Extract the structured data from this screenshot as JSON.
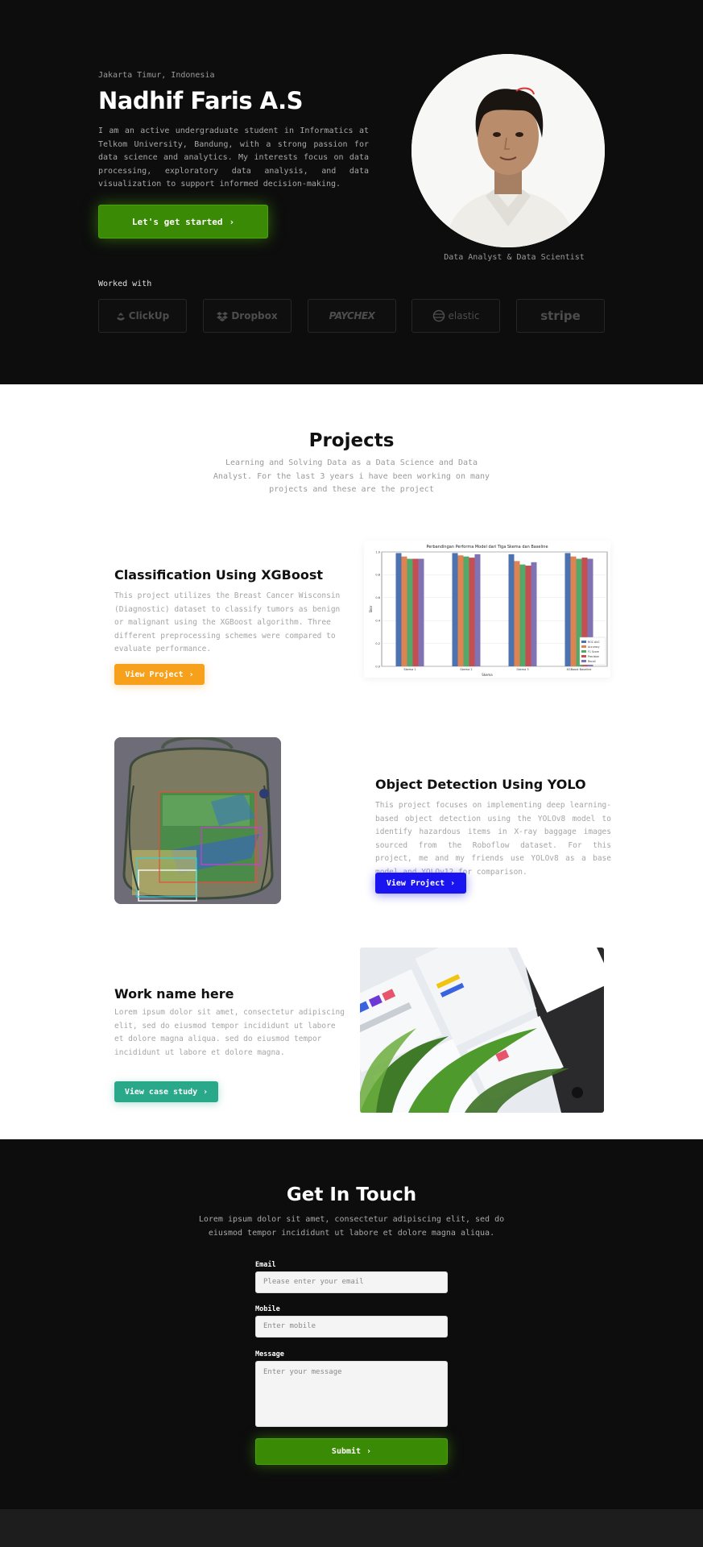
{
  "hero": {
    "location": "Jakarta Timur, Indonesia",
    "name": "Nadhif Faris A.S",
    "description": "I am an active undergraduate student in Informatics at Telkom University, Bandung, with a strong passion for data science and analytics. My interests focus on data processing, exploratory data analysis, and data visualization to support informed decision-making.",
    "cta_label": "Let's get started",
    "role": "Data Analyst & Data Scientist",
    "worked_with_label": "Worked with",
    "logos": [
      "ClickUp",
      "Dropbox",
      "PAYCHEX",
      "elastic",
      "stripe"
    ]
  },
  "projects": {
    "title": "Projects",
    "subtitle": "Learning and Solving Data as a Data Science and Data Analyst. For the last 3 years i have been working on many projects and these are the project",
    "items": [
      {
        "title": "Classification Using XGBoost",
        "description": "This project utilizes the Breast Cancer Wisconsin (Diagnostic) dataset to classify tumors as benign or malignant using the XGBoost algorithm. Three different preprocessing schemes were compared to evaluate performance.",
        "button": "View Project"
      },
      {
        "title": "Object Detection Using YOLO",
        "description": "This project focuses on implementing deep learning-based object detection using the YOLOv8 model to identify hazardous items in X-ray baggage images sourced from the Roboflow dataset. For this project, me and my friends use YOLOv8 as a base model and YOLOv12 for comparison.",
        "button": "View Project"
      },
      {
        "title": "Work name here",
        "description": "Lorem ipsum dolor sit amet, consectetur adipiscing elit, sed do eiusmod tempor incididunt ut labore et dolore magna aliqua. sed do eiusmod tempor incididunt ut labore et dolore magna.",
        "button": "View case study"
      }
    ]
  },
  "chart_data": {
    "type": "bar",
    "title": "Perbandingan Performa Model dari Tiga Skema dan Baseline",
    "xlabel": "Skema",
    "ylabel": "Skor",
    "ylim": [
      0,
      1.0
    ],
    "yticks": [
      "0.0",
      "0.2",
      "0.4",
      "0.6",
      "0.8",
      "1.0"
    ],
    "categories": [
      "Skema 1",
      "Skema 2",
      "Skema 3",
      "XGBoost Baseline"
    ],
    "legend_position": "bottom-right",
    "series": [
      {
        "name": "ROC AUC",
        "color": "#4c72b0",
        "values": [
          0.99,
          0.99,
          0.98,
          0.99
        ]
      },
      {
        "name": "Accuracy",
        "color": "#dd8452",
        "values": [
          0.96,
          0.97,
          0.92,
          0.96
        ]
      },
      {
        "name": "F1 Score",
        "color": "#55a868",
        "values": [
          0.94,
          0.96,
          0.89,
          0.94
        ]
      },
      {
        "name": "Precision",
        "color": "#c44e52",
        "values": [
          0.94,
          0.95,
          0.88,
          0.95
        ]
      },
      {
        "name": "Recall",
        "color": "#8172b3",
        "values": [
          0.94,
          0.98,
          0.91,
          0.94
        ]
      }
    ]
  },
  "contact": {
    "title": "Get In Touch",
    "subtitle": "Lorem ipsum dolor sit amet, consectetur adipiscing elit, sed do eiusmod tempor incididunt ut labore et dolore magna aliqua.",
    "email_label": "Email",
    "email_placeholder": "Please enter your email",
    "mobile_label": "Mobile",
    "mobile_placeholder": "Enter mobile",
    "message_label": "Message",
    "message_placeholder": "Enter your message",
    "submit_label": "Submit"
  },
  "colors": {
    "accent_green": "#3b8a05",
    "orange": "#f7a01b",
    "blue": "#1a14f0",
    "teal": "#2aa98a",
    "background_dark": "#0d0d0d"
  }
}
